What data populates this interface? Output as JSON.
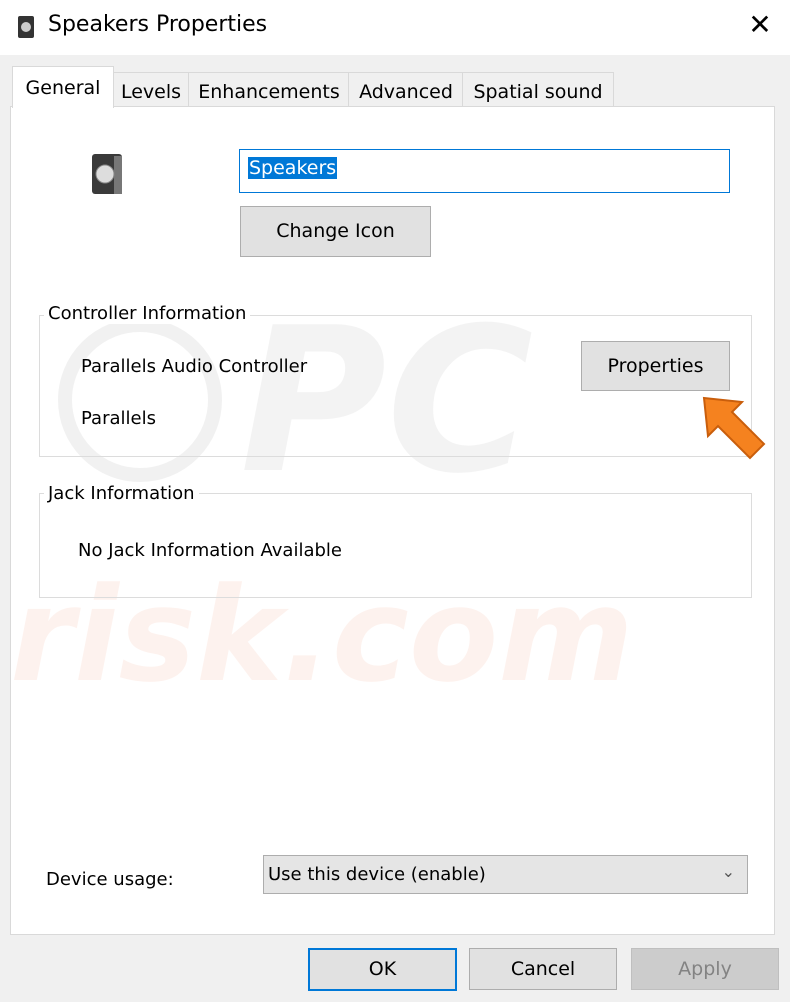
{
  "window": {
    "title": "Speakers Properties",
    "close": "✕"
  },
  "tabs": [
    {
      "label": "General",
      "active": true
    },
    {
      "label": "Levels"
    },
    {
      "label": "Enhancements"
    },
    {
      "label": "Advanced"
    },
    {
      "label": "Spatial sound"
    }
  ],
  "general": {
    "name_value": "Speakers",
    "change_icon": "Change Icon",
    "controller": {
      "legend": "Controller Information",
      "name": "Parallels Audio Controller",
      "vendor": "Parallels",
      "properties": "Properties"
    },
    "jack": {
      "legend": "Jack Information",
      "text": "No Jack Information Available"
    },
    "device_usage": {
      "label": "Device usage:",
      "value": "Use this device (enable)"
    }
  },
  "footer": {
    "ok": "OK",
    "cancel": "Cancel",
    "apply": "Apply"
  },
  "watermark": "PC risk.com",
  "colors": {
    "accent": "#0078d7",
    "arrow": "#f5821f"
  }
}
